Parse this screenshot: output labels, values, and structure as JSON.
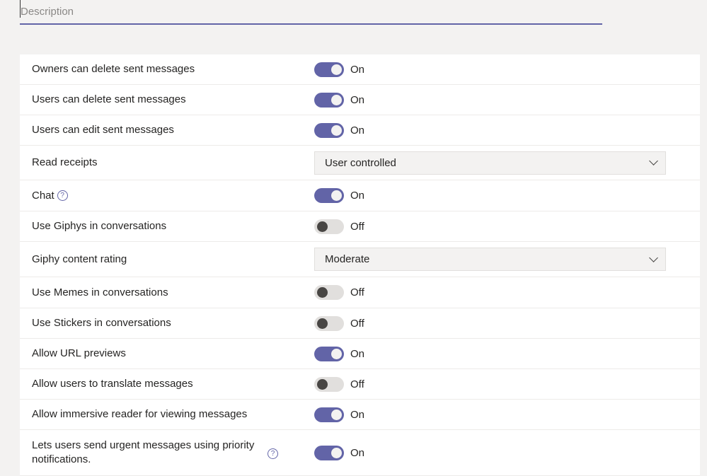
{
  "description": {
    "placeholder": "Description"
  },
  "settings": [
    {
      "label": "Owners can delete sent messages",
      "type": "toggle",
      "on": true,
      "state": "On"
    },
    {
      "label": "Users can delete sent messages",
      "type": "toggle",
      "on": true,
      "state": "On"
    },
    {
      "label": "Users can edit sent messages",
      "type": "toggle",
      "on": true,
      "state": "On"
    },
    {
      "label": "Read receipts",
      "type": "dropdown",
      "value": "User controlled"
    },
    {
      "label": "Chat",
      "type": "toggle",
      "on": true,
      "state": "On",
      "help": true
    },
    {
      "label": "Use Giphys in conversations",
      "type": "toggle",
      "on": false,
      "state": "Off"
    },
    {
      "label": "Giphy content rating",
      "type": "dropdown",
      "value": "Moderate"
    },
    {
      "label": "Use Memes in conversations",
      "type": "toggle",
      "on": false,
      "state": "Off"
    },
    {
      "label": "Use Stickers in conversations",
      "type": "toggle",
      "on": false,
      "state": "Off"
    },
    {
      "label": "Allow URL previews",
      "type": "toggle",
      "on": true,
      "state": "On"
    },
    {
      "label": "Allow users to translate messages",
      "type": "toggle",
      "on": false,
      "state": "Off"
    },
    {
      "label": "Allow immersive reader for viewing messages",
      "type": "toggle",
      "on": true,
      "state": "On"
    },
    {
      "label": "Lets users send urgent messages using priority notifications.",
      "type": "toggle",
      "on": true,
      "state": "On",
      "help": true,
      "helpRight": true
    }
  ],
  "help_glyph": "?"
}
